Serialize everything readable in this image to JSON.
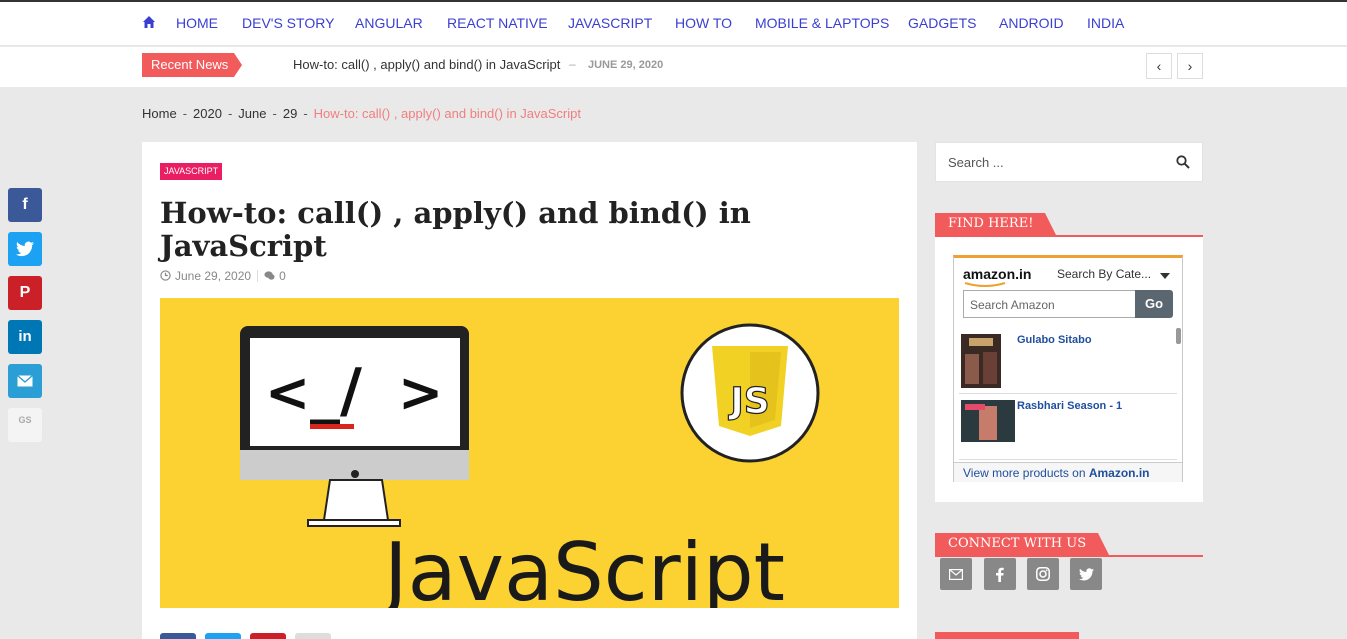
{
  "nav": {
    "items": [
      "HOME",
      "DEV'S STORY",
      "ANGULAR",
      "REACT NATIVE",
      "JAVASCRIPT",
      "HOW TO",
      "MOBILE & LAPTOPS",
      "GADGETS",
      "ANDROID",
      "INDIA"
    ]
  },
  "ticker": {
    "label": "Recent News",
    "title": "How-to: call() , apply() and bind() in JavaScript",
    "dash": "–",
    "date": "JUNE 29, 2020",
    "prev": "‹",
    "next": "›"
  },
  "breadcrumb": {
    "home": "Home",
    "year": "2020",
    "month": "June",
    "day": "29",
    "sep": "-",
    "current": "How-to: call() , apply() and bind() in JavaScript"
  },
  "article": {
    "category": "JAVASCRIPT",
    "title": "How-to: call() , apply() and bind() in JavaScript",
    "date": "June 29, 2020",
    "comments": "0",
    "hero": {
      "code_left": "<",
      "code_mid": "_/",
      "code_right": ">",
      "badge": "JS",
      "word": "JavaScript"
    }
  },
  "share_float": {
    "facebook": "f",
    "pinterest": "P",
    "linkedin": "in",
    "gs": "GS"
  },
  "sidebar": {
    "search_placeholder": "Search ...",
    "find_title": "FIND HERE!",
    "amazon": {
      "logo": "amazon.in",
      "category": "Search By Cate...",
      "input_placeholder": "Search Amazon",
      "go": "Go",
      "products": [
        "Gulabo Sitabo",
        "Rasbhari Season - 1"
      ],
      "footer_text": "View more products on ",
      "footer_brand": "Amazon.in"
    },
    "connect_title": "CONNECT WITH US"
  },
  "colors": {
    "nav_link": "#3b3fd1",
    "accent": "#f25b5b",
    "category_tag": "#e91e63",
    "hero_bg": "#fbd232"
  }
}
